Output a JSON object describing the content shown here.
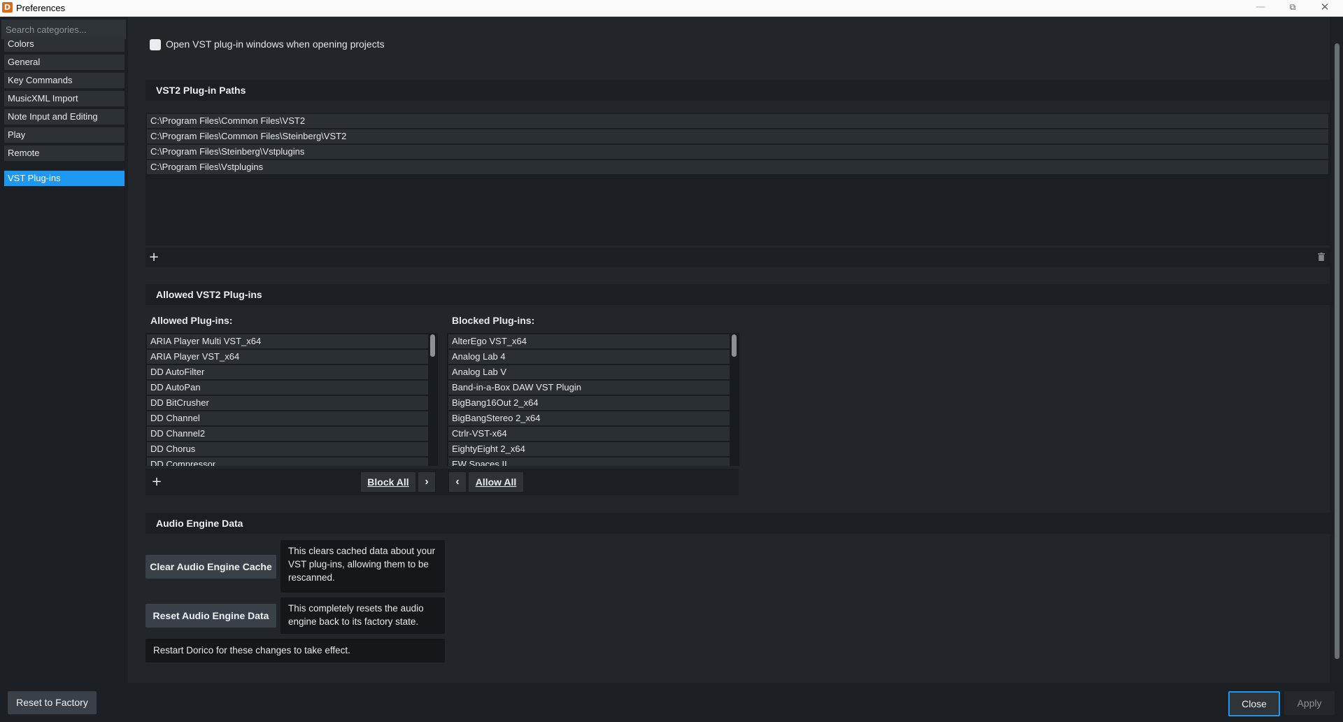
{
  "window": {
    "title": "Preferences",
    "app_icon_letter": "D",
    "controls": {
      "minimize": "—",
      "maximize": "⧉",
      "close": "✕"
    }
  },
  "sidebar": {
    "search_placeholder": "Search categories...",
    "categories": [
      {
        "label": "Colors"
      },
      {
        "label": "General"
      },
      {
        "label": "Key Commands"
      },
      {
        "label": "MusicXML Import"
      },
      {
        "label": "Note Input and Editing"
      },
      {
        "label": "Play"
      },
      {
        "label": "Remote"
      },
      {
        "label": "VST Plug-ins",
        "selected": true
      }
    ]
  },
  "main": {
    "open_vst_windows": {
      "label": "Open VST plug-in windows when opening projects",
      "checked": false
    },
    "vst2_paths": {
      "title": "VST2 Plug-in Paths",
      "paths": [
        "C:\\Program Files\\Common Files\\VST2",
        "C:\\Program Files\\Common Files\\Steinberg\\VST2",
        "C:\\Program Files\\Steinberg\\Vstplugins",
        "C:\\Program Files\\Vstplugins"
      ],
      "add_icon": "+"
    },
    "allowed_vst2": {
      "title": "Allowed VST2 Plug-ins",
      "allowed_label": "Allowed Plug-ins:",
      "blocked_label": "Blocked Plug-ins:",
      "allowed": [
        "ARIA Player Multi VST_x64",
        "ARIA Player VST_x64",
        "DD AutoFilter",
        "DD AutoPan",
        "DD BitCrusher",
        "DD Channel",
        "DD Channel2",
        "DD Chorus",
        "DD Compressor"
      ],
      "blocked": [
        "AlterEgo VST_x64",
        "Analog Lab 4",
        "Analog Lab V",
        "Band-in-a-Box DAW VST Plugin",
        "BigBang16Out 2_x64",
        "BigBangStereo 2_x64",
        "Ctrlr-VST-x64",
        "EightyEight 2_x64",
        "EW Spaces II"
      ],
      "add_icon": "+",
      "block_all": "Block All",
      "allow_all": "Allow All",
      "move_right": "›",
      "move_left": "‹"
    },
    "audio_engine": {
      "title": "Audio Engine Data",
      "clear_button": "Clear Audio Engine Cache",
      "clear_desc": "This clears cached data about your VST plug-ins, allowing them to be rescanned.",
      "reset_button": "Reset Audio Engine Data",
      "reset_desc": "This completely resets the audio engine back to its factory state.",
      "restart_note": "Restart Dorico for these changes to take effect."
    }
  },
  "footer": {
    "reset_factory": "Reset to Factory",
    "close": "Close",
    "apply": "Apply"
  },
  "colors": {
    "accent": "#1e97f0",
    "background": "#22262b",
    "app_icon": "#e06a13"
  }
}
